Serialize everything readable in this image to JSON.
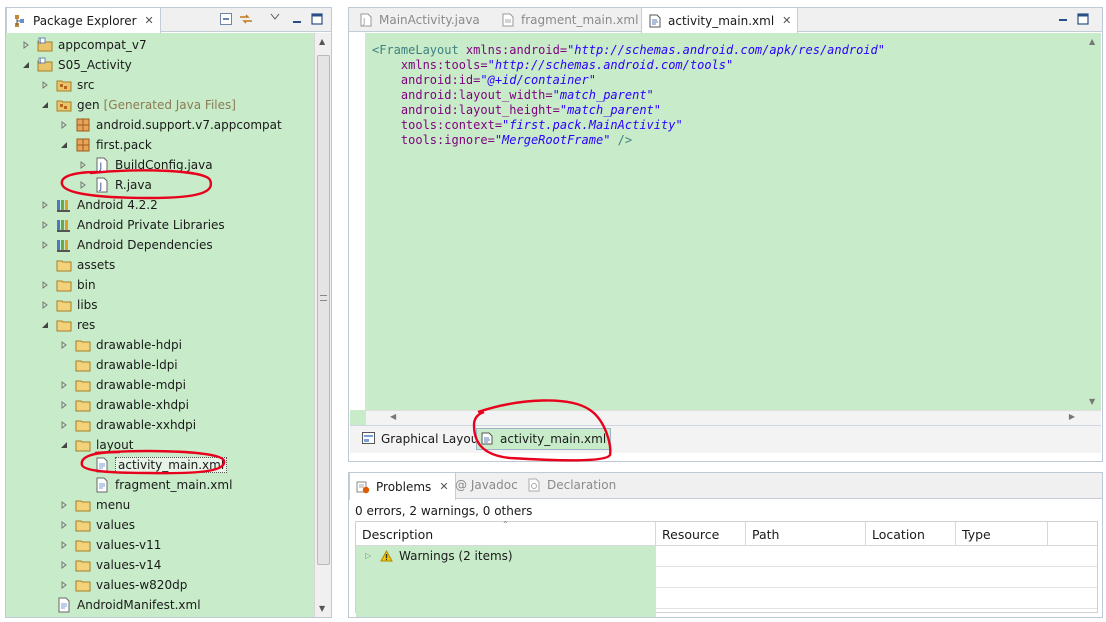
{
  "package_explorer": {
    "title": "Package Explorer",
    "items": [
      {
        "label": "appcompat_v7",
        "depth": 0,
        "toggle": "closed",
        "icon": "project-icon"
      },
      {
        "label": "S05_Activity",
        "depth": 0,
        "toggle": "open",
        "icon": "project-icon"
      },
      {
        "label": "src",
        "depth": 1,
        "toggle": "closed",
        "icon": "source-folder-icon"
      },
      {
        "label": "gen",
        "suffix": "[Generated Java Files]",
        "depth": 1,
        "toggle": "open",
        "icon": "source-folder-icon"
      },
      {
        "label": "android.support.v7.appcompat",
        "depth": 2,
        "toggle": "closed",
        "icon": "package-icon"
      },
      {
        "label": "first.pack",
        "depth": 2,
        "toggle": "open",
        "icon": "package-icon"
      },
      {
        "label": "BuildConfig.java",
        "depth": 3,
        "toggle": "closed",
        "icon": "java-file-icon"
      },
      {
        "label": "R.java",
        "depth": 3,
        "toggle": "closed",
        "icon": "java-file-icon"
      },
      {
        "label": "Android 4.2.2",
        "depth": 1,
        "toggle": "closed",
        "icon": "library-icon"
      },
      {
        "label": "Android Private Libraries",
        "depth": 1,
        "toggle": "closed",
        "icon": "library-icon"
      },
      {
        "label": "Android Dependencies",
        "depth": 1,
        "toggle": "closed",
        "icon": "library-icon"
      },
      {
        "label": "assets",
        "depth": 1,
        "toggle": "none",
        "icon": "folder-icon"
      },
      {
        "label": "bin",
        "depth": 1,
        "toggle": "closed",
        "icon": "folder-icon"
      },
      {
        "label": "libs",
        "depth": 1,
        "toggle": "closed",
        "icon": "folder-icon"
      },
      {
        "label": "res",
        "depth": 1,
        "toggle": "open",
        "icon": "folder-icon"
      },
      {
        "label": "drawable-hdpi",
        "depth": 2,
        "toggle": "closed",
        "icon": "folder-icon"
      },
      {
        "label": "drawable-ldpi",
        "depth": 2,
        "toggle": "none",
        "icon": "folder-icon"
      },
      {
        "label": "drawable-mdpi",
        "depth": 2,
        "toggle": "closed",
        "icon": "folder-icon"
      },
      {
        "label": "drawable-xhdpi",
        "depth": 2,
        "toggle": "closed",
        "icon": "folder-icon"
      },
      {
        "label": "drawable-xxhdpi",
        "depth": 2,
        "toggle": "closed",
        "icon": "folder-icon"
      },
      {
        "label": "layout",
        "depth": 2,
        "toggle": "open",
        "icon": "folder-icon"
      },
      {
        "label": "activity_main.xml",
        "depth": 3,
        "toggle": "none",
        "icon": "xml-file-icon",
        "selected": true
      },
      {
        "label": "fragment_main.xml",
        "depth": 3,
        "toggle": "none",
        "icon": "xml-file-icon"
      },
      {
        "label": "menu",
        "depth": 2,
        "toggle": "closed",
        "icon": "folder-icon"
      },
      {
        "label": "values",
        "depth": 2,
        "toggle": "closed",
        "icon": "folder-icon"
      },
      {
        "label": "values-v11",
        "depth": 2,
        "toggle": "closed",
        "icon": "folder-icon"
      },
      {
        "label": "values-v14",
        "depth": 2,
        "toggle": "closed",
        "icon": "folder-icon"
      },
      {
        "label": "values-w820dp",
        "depth": 2,
        "toggle": "closed",
        "icon": "folder-icon"
      },
      {
        "label": "AndroidManifest.xml",
        "depth": 1,
        "toggle": "none",
        "icon": "xml-file-icon"
      }
    ]
  },
  "editor": {
    "tabs": [
      {
        "label": "MainActivity.java",
        "icon": "java-file-icon",
        "active": false
      },
      {
        "label": "fragment_main.xml",
        "icon": "xml-file-icon",
        "active": false
      },
      {
        "label": "activity_main.xml",
        "icon": "xml-file-icon",
        "active": true
      }
    ],
    "code": {
      "l1_tag": "<FrameLayout",
      "l1_attr": " xmlns:android=",
      "l1_val": "\"http://schemas.android.com/apk/res/android\"",
      "l2_attr": "    xmlns:tools=",
      "l2_val": "\"http://schemas.android.com/tools\"",
      "l3_attr": "    android:id=",
      "l3_val": "\"@+id/container\"",
      "l4_attr": "    android:layout_width=",
      "l4_val": "\"match_parent\"",
      "l5_attr": "    android:layout_height=",
      "l5_val": "\"match_parent\"",
      "l6_attr": "    tools:context=",
      "l6_val": "\"first.pack.MainActivity\"",
      "l7_attr": "    tools:ignore=",
      "l7_val": "\"MergeRootFrame\"",
      "l7_end": " />"
    },
    "bottom_tabs": {
      "graphical": "Graphical Layout",
      "xml": "activity_main.xml"
    }
  },
  "problems": {
    "tabs": {
      "problems": "Problems",
      "javadoc": "@ Javadoc",
      "declaration": "Declaration"
    },
    "summary": "0 errors, 2 warnings, 0 others",
    "columns": [
      "Description",
      "Resource",
      "Path",
      "Location",
      "Type"
    ],
    "rows": [
      {
        "description": "Warnings (2 items)"
      }
    ]
  },
  "colors": {
    "accent_green": "#c8ecc9",
    "annotation_red": "#e8001c"
  }
}
